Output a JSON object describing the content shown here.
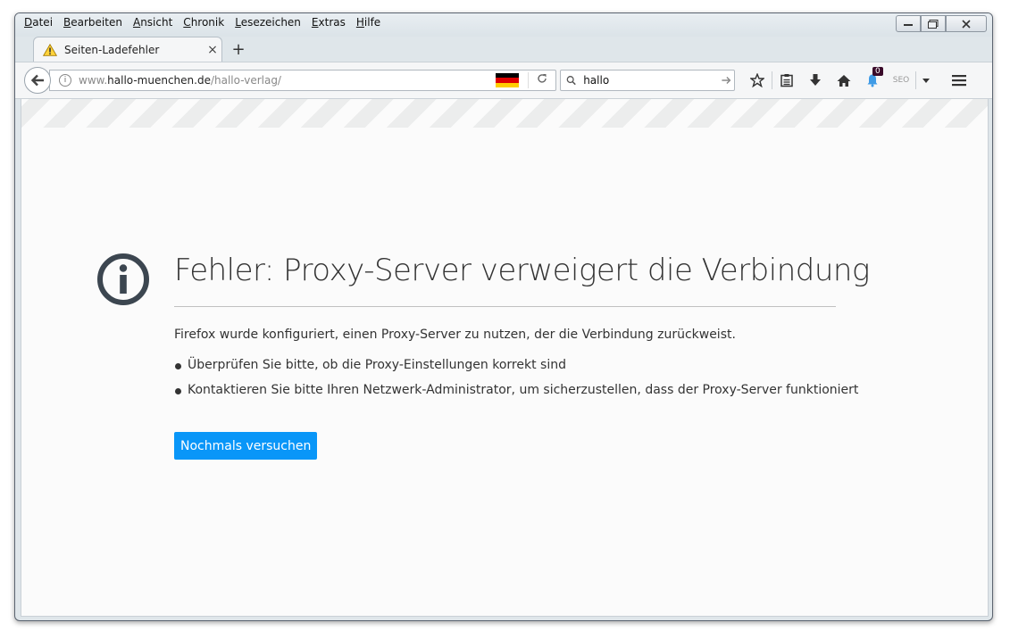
{
  "menu": {
    "items": [
      "Datei",
      "Bearbeiten",
      "Ansicht",
      "Chronik",
      "Lesezeichen",
      "Extras",
      "Hilfe"
    ],
    "accel": [
      "D",
      "B",
      "A",
      "C",
      "L",
      "E",
      "H"
    ]
  },
  "tab": {
    "title": "Seiten-Ladefehler",
    "close": "×",
    "new_tab": "+"
  },
  "urlbar": {
    "prefix": "www.",
    "domain": "hallo-muenchen.de",
    "path": "/hallo-verlag/"
  },
  "search": {
    "value": "hallo"
  },
  "toolbar": {
    "notification_count": "0",
    "seo_label": "SEO"
  },
  "error": {
    "title": "Fehler: Proxy-Server verweigert die Verbindung",
    "description": "Firefox wurde konfiguriert, einen Proxy-Server zu nutzen, der die Verbindung zurückweist.",
    "bullets": [
      "Überprüfen Sie bitte, ob die Proxy-Einstellungen korrekt sind",
      "Kontaktieren Sie bitte Ihren Netzwerk-Administrator, um sicherzustellen, dass der Proxy-Server funktioniert"
    ],
    "retry_label": "Nochmals versuchen"
  },
  "colors": {
    "accent": "#0996f8",
    "flag_black": "#000000",
    "flag_red": "#dd0000",
    "flag_gold": "#ffce00"
  }
}
